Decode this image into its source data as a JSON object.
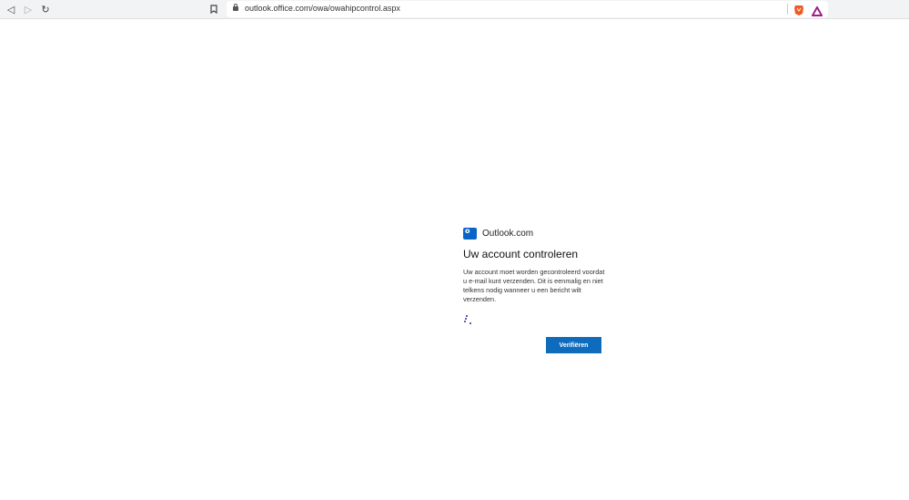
{
  "browser": {
    "url": "outlook.office.com/owa/owahipcontrol.aspx"
  },
  "card": {
    "brand": "Outlook.com",
    "title": "Uw account controleren",
    "description": "Uw account moet worden gecontroleerd voordat u e-mail kunt verzenden. Dit is eenmalig en niet telkens nodig wanneer u een bericht wilt verzenden.",
    "verify_label": "Verifiëren"
  },
  "colors": {
    "accent": "#0f6cbd"
  }
}
